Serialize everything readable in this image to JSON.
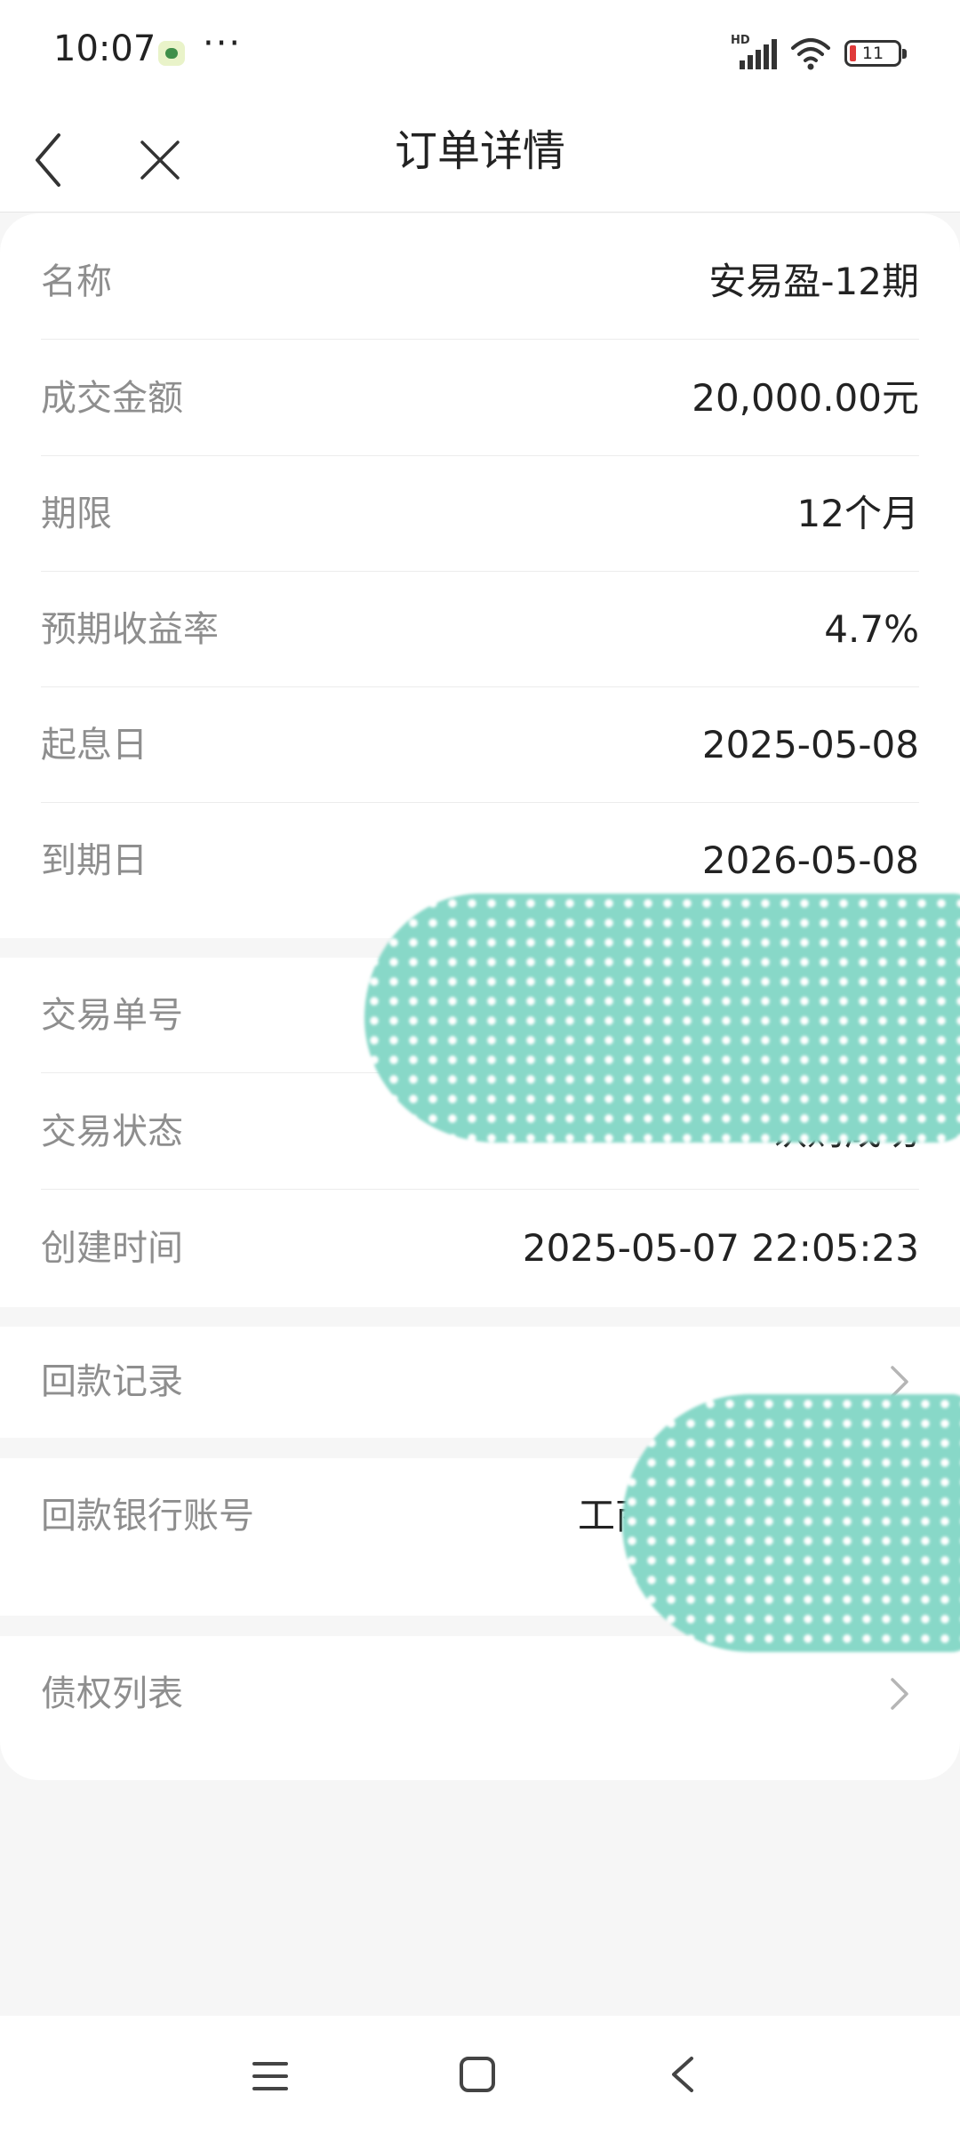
{
  "status_bar": {
    "time": "10:07",
    "more": "···",
    "network_label": "HD",
    "battery_level": "11"
  },
  "nav": {
    "title": "订单详情"
  },
  "order": {
    "name_label": "名称",
    "name_value": "安易盈-12期",
    "amount_label": "成交金额",
    "amount_value": "20,000.00元",
    "term_label": "期限",
    "term_value": "12个月",
    "rate_label": "预期收益率",
    "rate_value": "4.7%",
    "start_label": "起息日",
    "start_value": "2025-05-08",
    "end_label": "到期日",
    "end_value": "2026-05-08"
  },
  "trade": {
    "number_label": "交易单号",
    "status_label": "交易状态",
    "status_value": "认购成功",
    "created_label": "创建时间",
    "created_value": "2025-05-07 22:05:23"
  },
  "repayment": {
    "records_label": "回款记录",
    "bank_label": "回款银行账号",
    "bank_value": "工商"
  },
  "debt": {
    "list_label": "债权列表"
  },
  "colors": {
    "accent_redaction": "#88d8c8",
    "battery_low": "#e03a3a"
  }
}
